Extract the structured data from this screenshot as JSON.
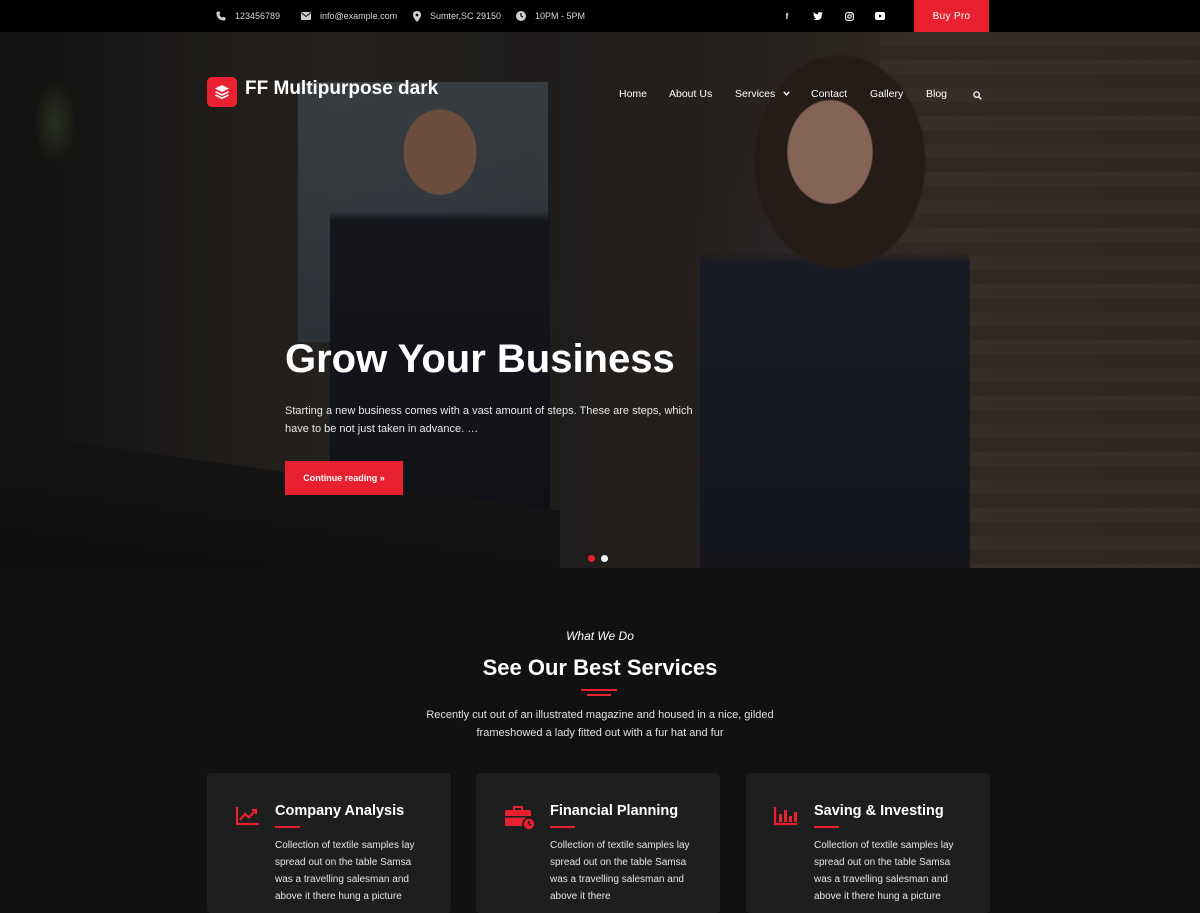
{
  "topbar": {
    "phone": "123456789",
    "email": "info@example.com",
    "address": "Sumter,SC 29150",
    "hours": "10PM - 5PM",
    "socials": [
      {
        "icon": "facebook-icon",
        "glyph": "f"
      },
      {
        "icon": "twitter-icon",
        "glyph": "t"
      },
      {
        "icon": "instagram-icon",
        "glyph": "◎"
      },
      {
        "icon": "youtube-icon",
        "glyph": "▶"
      }
    ],
    "buy_pro": "Buy Pro"
  },
  "header": {
    "site_title": "FF Multipurpose dark",
    "nav": [
      "Home",
      "About Us",
      "Services",
      "Contact",
      "Gallery",
      "Blog"
    ]
  },
  "hero": {
    "title": "Grow Your Business",
    "description": "Starting a new business comes with a vast amount of steps. These are steps, which have to be not just taken in advance. …",
    "button": "Continue reading »",
    "slides_active": 0
  },
  "services": {
    "tag": "What We Do",
    "title": "See Our Best Services",
    "description": "Recently cut out of an illustrated magazine and housed in a nice, gilded frameshowed a lady fitted out with a fur hat and fur",
    "cards": [
      {
        "icon": "chart-line-icon",
        "title": "Company Analysis",
        "text": "Collection of textile samples lay spread out on the table Samsa was a travelling salesman and above it there hung a picture"
      },
      {
        "icon": "briefcase-clock-icon",
        "title": "Financial Planning",
        "text": "Collection of textile samples lay spread out on the table Samsa was a travelling salesman and above it there"
      },
      {
        "icon": "bar-chart-icon",
        "title": "Saving & Investing",
        "text": "Collection of textile samples lay spread out on the table Samsa was a travelling salesman and above it there hung a picture"
      }
    ]
  },
  "colors": {
    "accent": "#e9202f",
    "background": "#111111",
    "card": "#1e1e1e",
    "topbar": "#000000"
  }
}
